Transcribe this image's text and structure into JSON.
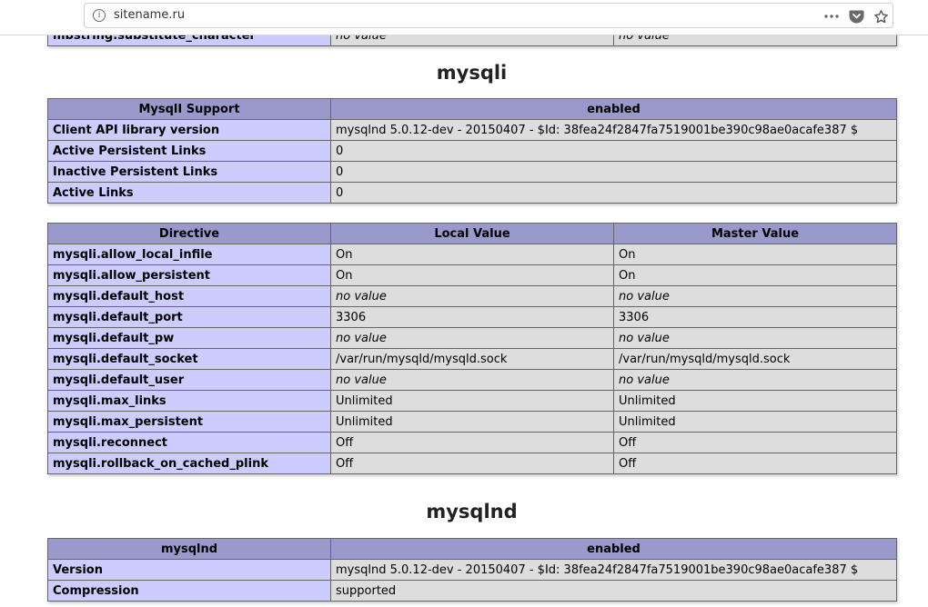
{
  "browser": {
    "url": "sitename.ru",
    "info_glyph": "i"
  },
  "prev_row": {
    "name": "mbstring.substitute_character",
    "local": "no value",
    "master": "no value"
  },
  "mysqli": {
    "heading": "mysqli",
    "support_table": {
      "header": [
        "MysqlI Support",
        "enabled"
      ],
      "rows": [
        {
          "name": "Client API library version",
          "value": "mysqlnd 5.0.12-dev - 20150407 - $Id: 38fea24f2847fa7519001be390c98ae0acafe387 $"
        },
        {
          "name": "Active Persistent Links",
          "value": "0"
        },
        {
          "name": "Inactive Persistent Links",
          "value": "0"
        },
        {
          "name": "Active Links",
          "value": "0"
        }
      ]
    },
    "directive_table": {
      "header": [
        "Directive",
        "Local Value",
        "Master Value"
      ],
      "rows": [
        {
          "name": "mysqli.allow_local_infile",
          "local": "On",
          "master": "On"
        },
        {
          "name": "mysqli.allow_persistent",
          "local": "On",
          "master": "On"
        },
        {
          "name": "mysqli.default_host",
          "local": "no value",
          "master": "no value"
        },
        {
          "name": "mysqli.default_port",
          "local": "3306",
          "master": "3306"
        },
        {
          "name": "mysqli.default_pw",
          "local": "no value",
          "master": "no value"
        },
        {
          "name": "mysqli.default_socket",
          "local": "/var/run/mysqld/mysqld.sock",
          "master": "/var/run/mysqld/mysqld.sock"
        },
        {
          "name": "mysqli.default_user",
          "local": "no value",
          "master": "no value"
        },
        {
          "name": "mysqli.max_links",
          "local": "Unlimited",
          "master": "Unlimited"
        },
        {
          "name": "mysqli.max_persistent",
          "local": "Unlimited",
          "master": "Unlimited"
        },
        {
          "name": "mysqli.reconnect",
          "local": "Off",
          "master": "Off"
        },
        {
          "name": "mysqli.rollback_on_cached_plink",
          "local": "Off",
          "master": "Off"
        }
      ]
    }
  },
  "mysqlnd": {
    "heading": "mysqlnd",
    "table": {
      "header": [
        "mysqlnd",
        "enabled"
      ],
      "rows": [
        {
          "name": "Version",
          "value": "mysqlnd 5.0.12-dev - 20150407 - $Id: 38fea24f2847fa7519001be390c98ae0acafe387 $"
        },
        {
          "name": "Compression",
          "value": "supported"
        }
      ]
    }
  },
  "colors": {
    "header_bg": "#9999cc",
    "key_bg": "#ccccff",
    "value_bg": "#dddddd",
    "no_value_text": "#999999"
  }
}
